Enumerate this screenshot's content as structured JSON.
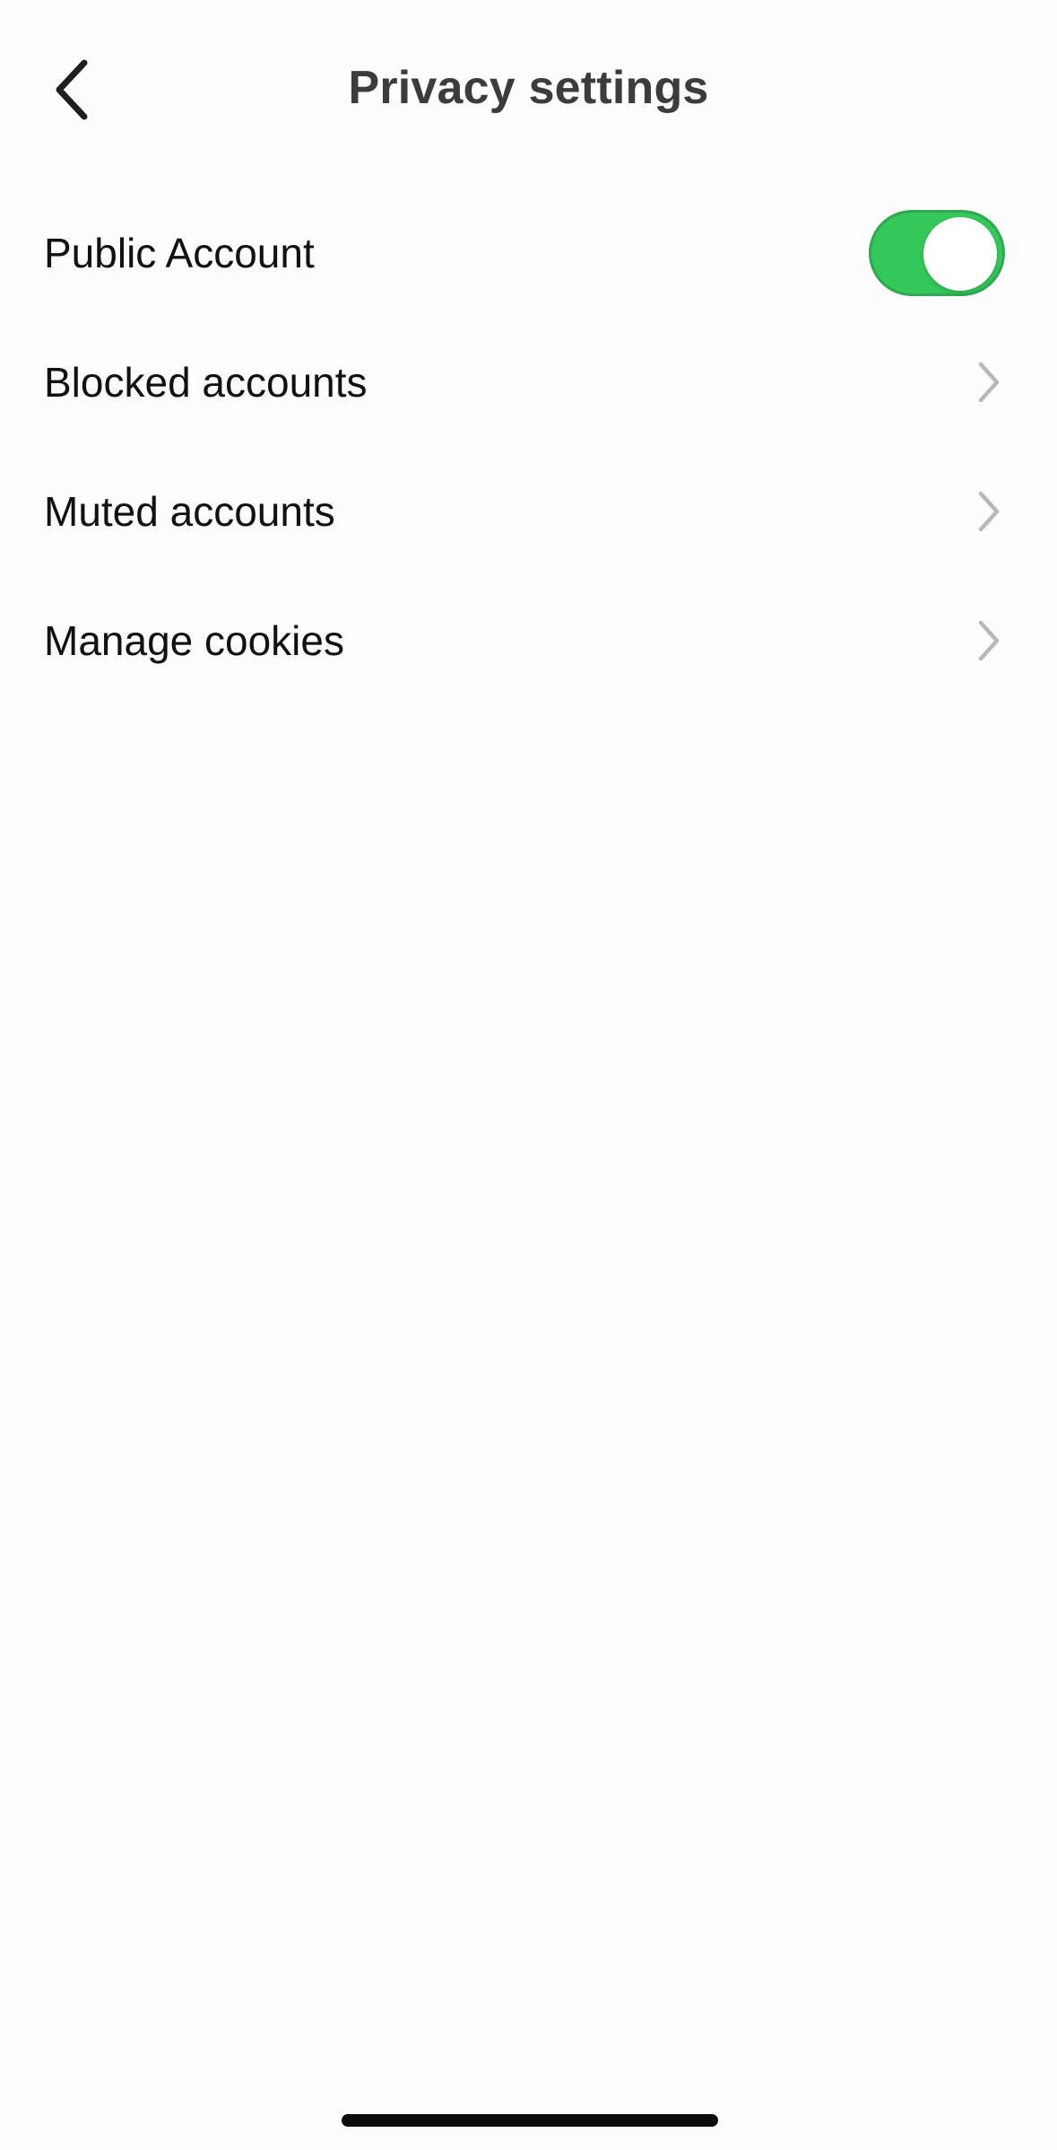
{
  "header": {
    "title": "Privacy settings",
    "back_icon": "chevron-left-icon"
  },
  "settings": {
    "public_account": {
      "label": "Public Account",
      "enabled": true
    },
    "items": [
      {
        "label": "Blocked accounts",
        "icon": "chevron-right-icon"
      },
      {
        "label": "Muted accounts",
        "icon": "chevron-right-icon"
      },
      {
        "label": "Manage cookies",
        "icon": "chevron-right-icon"
      }
    ]
  },
  "colors": {
    "toggle_on": "#34c759",
    "title": "#3c3c3c",
    "chevron": "#b8b8b8"
  }
}
